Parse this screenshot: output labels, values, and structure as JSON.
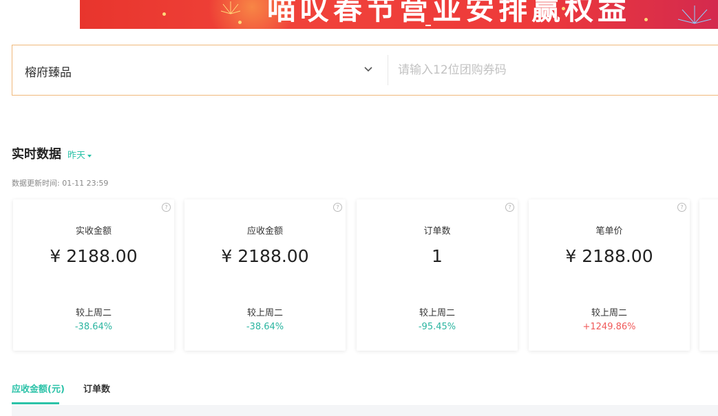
{
  "banner": {
    "title": "喵叹春节营业安排赢权益"
  },
  "store_selector": {
    "selected_store": "榕府臻品",
    "coupon_placeholder": "请输入12位团购券码"
  },
  "realtime": {
    "title": "实时数据",
    "date_filter": "昨天",
    "update_time": "数据更新时间: 01-11 23:59"
  },
  "metrics": [
    {
      "label": "实收金额",
      "value": "¥ 2188.00",
      "compare": "较上周二",
      "change": "-38.64%",
      "trend": "down"
    },
    {
      "label": "应收金额",
      "value": "¥ 2188.00",
      "compare": "较上周二",
      "change": "-38.64%",
      "trend": "down"
    },
    {
      "label": "订单数",
      "value": "1",
      "compare": "较上周二",
      "change": "-95.45%",
      "trend": "down"
    },
    {
      "label": "笔单价",
      "value": "¥ 2188.00",
      "compare": "较上周二",
      "change": "+1249.86%",
      "trend": "up"
    }
  ],
  "tabs": [
    {
      "label": "应收金额(元)",
      "active": true
    },
    {
      "label": "订单数",
      "active": false
    }
  ],
  "colors": {
    "accent": "#2bc2a8",
    "decrease": "#2bb5a0",
    "increase": "#f05a5a",
    "selector_border": "#f0b87a",
    "banner_red": "#e8352d"
  }
}
